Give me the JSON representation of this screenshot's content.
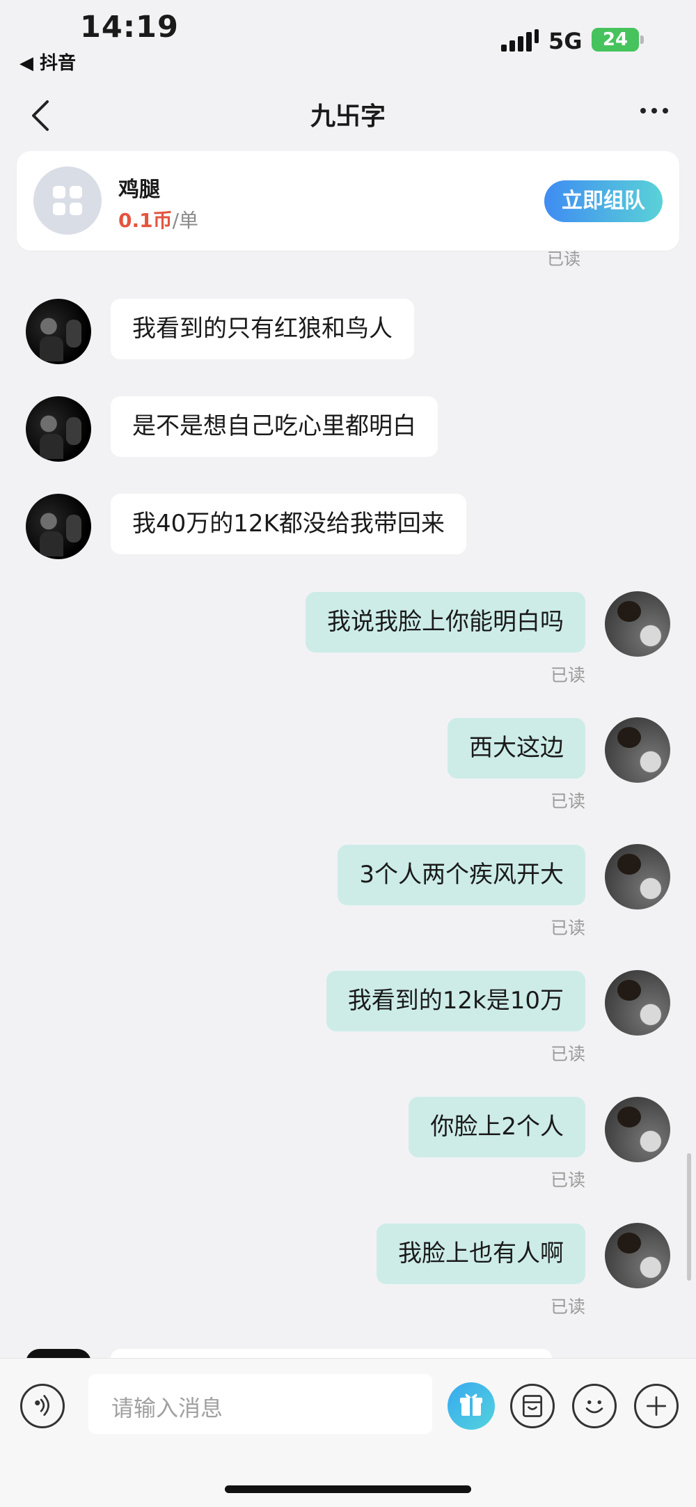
{
  "status_bar": {
    "time": "14:19",
    "back_app": "◀ 抖音",
    "network": "5G",
    "battery": "24"
  },
  "header": {
    "title": "九卐字",
    "back_icon": "chevron-left-icon",
    "more_icon": "more-dots-icon"
  },
  "card": {
    "name": "鸡腿",
    "price": "0.1币",
    "unit": "/单",
    "button": "立即组队",
    "icon": "grid-icon"
  },
  "cut_read": "已读",
  "messages": [
    {
      "side": "left",
      "text": "我看到的只有红狼和鸟人"
    },
    {
      "side": "left",
      "text": "是不是想自己吃心里都明白"
    },
    {
      "side": "left",
      "text": "我40万的12K都没给我带回来"
    },
    {
      "side": "right",
      "text": "我说我脸上你能明白吗",
      "status": "已读"
    },
    {
      "side": "right",
      "text": "西大这边",
      "status": "已读"
    },
    {
      "side": "right",
      "text": "3个人两个疾风开大",
      "status": "已读"
    },
    {
      "side": "right",
      "text": "我看到的12k是10万",
      "status": "已读"
    },
    {
      "side": "right",
      "text": "你脸上2个人",
      "status": "已读"
    },
    {
      "side": "right",
      "text": "我脸上也有人啊",
      "status": "已读"
    }
  ],
  "input": {
    "placeholder": "请输入消息",
    "voice_icon": "voice-icon",
    "gift_icon": "gift-icon",
    "emoji_pack_icon": "emoji-pack-icon",
    "emoji_icon": "smiley-icon",
    "add_icon": "plus-icon"
  },
  "colors": {
    "background": "#f2f2f4",
    "my_bubble": "#cdece8",
    "price": "#e4543f",
    "button_gradient_start": "#3f8cf2",
    "button_gradient_end": "#5ad2d7"
  }
}
